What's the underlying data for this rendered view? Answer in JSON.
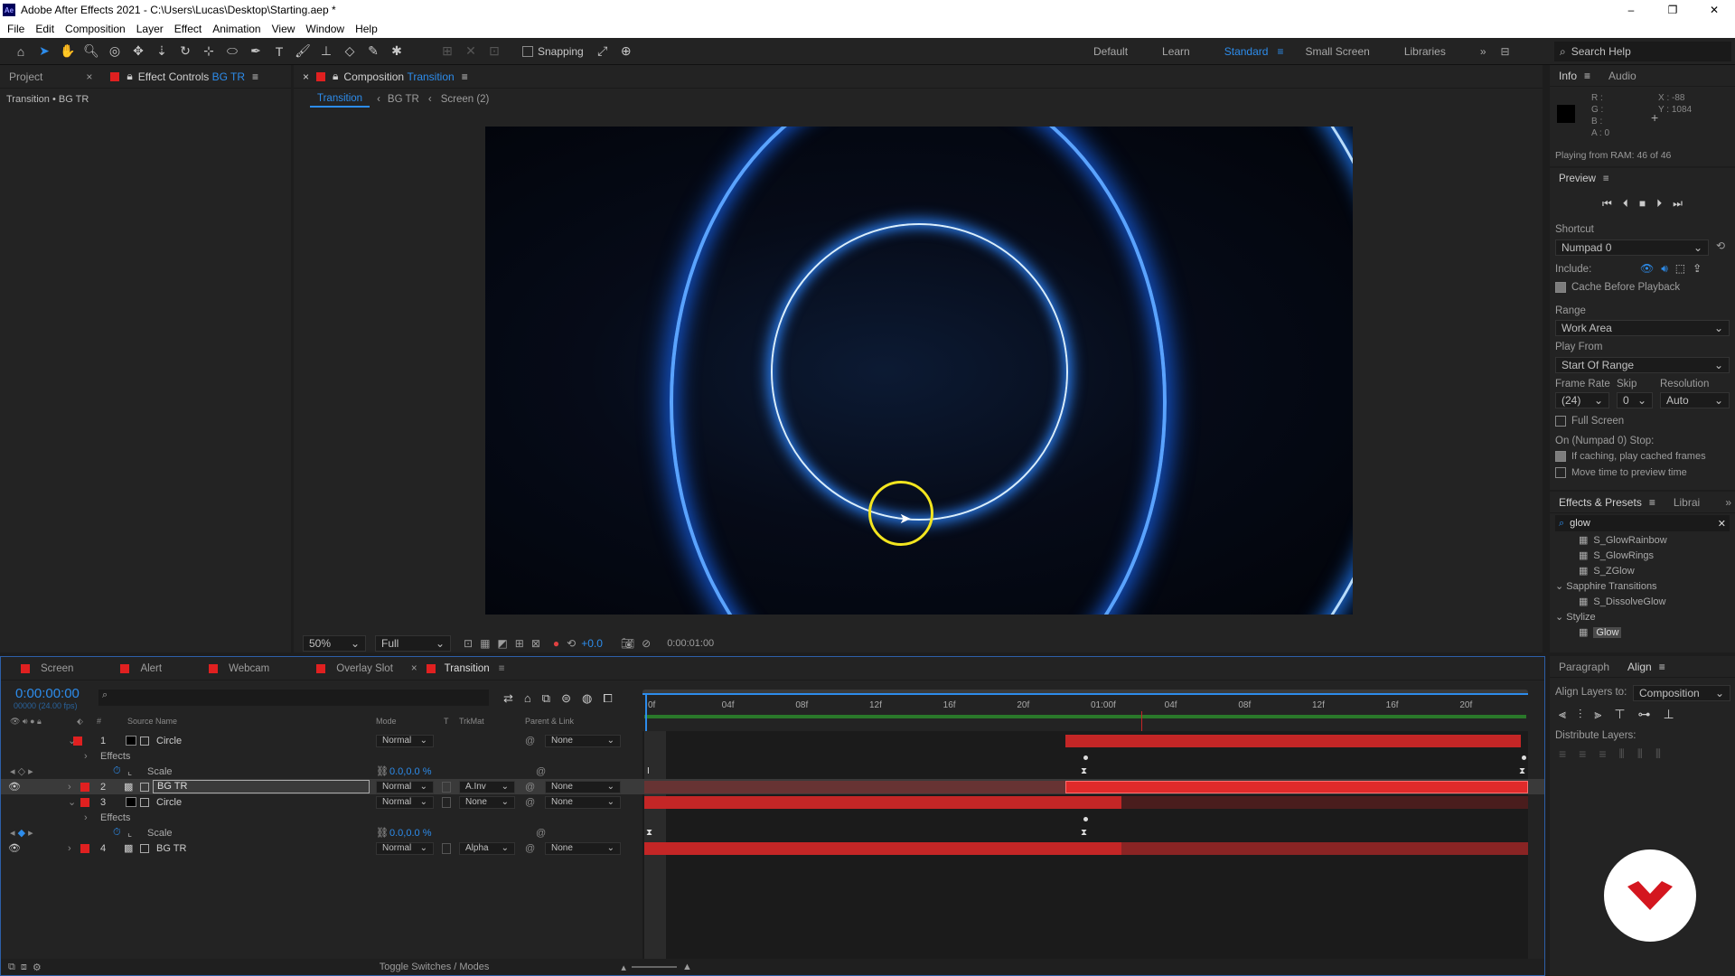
{
  "window": {
    "app_icon": "Ae",
    "title": "Adobe After Effects 2021 - C:\\Users\\Lucas\\Desktop\\Starting.aep *",
    "minimize": "–",
    "maximize": "❐",
    "close": "✕"
  },
  "menu": [
    "File",
    "Edit",
    "Composition",
    "Layer",
    "Effect",
    "Animation",
    "View",
    "Window",
    "Help"
  ],
  "toolbar": {
    "snapping_label": "Snapping",
    "workspaces": [
      "Default",
      "Learn",
      "Standard",
      "Small Screen",
      "Libraries"
    ],
    "active_workspace": "Standard",
    "search_help": "Search Help"
  },
  "left_panel": {
    "tab_project": "Project",
    "tab_effect_controls": "Effect Controls",
    "tab_effect_controls_layer": "BG TR",
    "breadcrumb": "Transition • BG TR"
  },
  "composition_panel": {
    "tab_label": "Composition",
    "tab_comp_name": "Transition",
    "nav": [
      "Transition",
      "BG TR",
      "Screen (2)"
    ],
    "zoom": "50%",
    "resolution": "Full",
    "exposure": "+0.0",
    "timecode": "0:00:01:00"
  },
  "info_panel": {
    "tab_info": "Info",
    "tab_audio": "Audio",
    "r": "R :",
    "g": "G :",
    "b": "B :",
    "a": "A :  0",
    "x": "X : -88",
    "y": "Y : 1084",
    "status": "Playing from RAM: 46 of 46"
  },
  "preview_panel": {
    "title": "Preview",
    "shortcut_label": "Shortcut",
    "shortcut_value": "Numpad 0",
    "include_label": "Include:",
    "cache_before": "Cache Before Playback",
    "range_label": "Range",
    "range_value": "Work Area",
    "play_from_label": "Play From",
    "play_from_value": "Start Of Range",
    "frame_rate_label": "Frame Rate",
    "skip_label": "Skip",
    "resolution_label": "Resolution",
    "frame_rate_value": "(24)",
    "skip_value": "0",
    "resolution_value": "Auto",
    "full_screen": "Full Screen",
    "stop_label": "On (Numpad 0) Stop:",
    "if_caching": "If caching, play cached frames",
    "move_time": "Move time to preview time"
  },
  "effects_presets": {
    "tab": "Effects & Presets",
    "tab2": "Librai",
    "search": "glow",
    "items": [
      "S_GlowRainbow",
      "S_GlowRings",
      "S_ZGlow"
    ],
    "group1": "Sapphire Transitions",
    "group1_items": [
      "S_DissolveGlow"
    ],
    "group2": "Stylize",
    "group2_items": [
      "Glow"
    ]
  },
  "align_panel": {
    "tab_paragraph": "Paragraph",
    "tab_align": "Align",
    "align_layers_to": "Align Layers to:",
    "align_target": "Composition",
    "distribute": "Distribute Layers:"
  },
  "timeline": {
    "comp_tabs": [
      "Screen",
      "Alert",
      "Webcam",
      "Overlay Slot",
      "Transition"
    ],
    "active_tab": "Transition",
    "timecode": "0:00:00:00",
    "fps_sub": "00000 (24.00 fps)",
    "col_source": "Source Name",
    "col_mode": "Mode",
    "col_t": "T",
    "col_trkmat": "TrkMat",
    "col_parent": "Parent & Link",
    "ruler": [
      "0f",
      "04f",
      "08f",
      "12f",
      "16f",
      "20f",
      "01:00f",
      "04f",
      "08f",
      "12f",
      "16f",
      "20f"
    ],
    "layers": [
      {
        "num": "1",
        "name": "Circle",
        "mode": "Normal",
        "trkmat": "",
        "parent": "None"
      },
      {
        "num": "2",
        "name": "BG TR",
        "mode": "Normal",
        "trkmat": "A.Inv",
        "parent": "None"
      },
      {
        "num": "3",
        "name": "Circle",
        "mode": "Normal",
        "trkmat": "None",
        "parent": "None"
      },
      {
        "num": "4",
        "name": "BG TR",
        "mode": "Normal",
        "trkmat": "Alpha",
        "parent": "None"
      }
    ],
    "effects_label": "Effects",
    "scale_label": "Scale",
    "scale_value": "0.0,0.0 %",
    "toggle_label": "Toggle Switches / Modes"
  },
  "colors": {
    "accent": "#2d8ceb",
    "label_red": "#e02020",
    "bar_red": "#c42626",
    "cursor_highlight": "#f3e51f"
  }
}
